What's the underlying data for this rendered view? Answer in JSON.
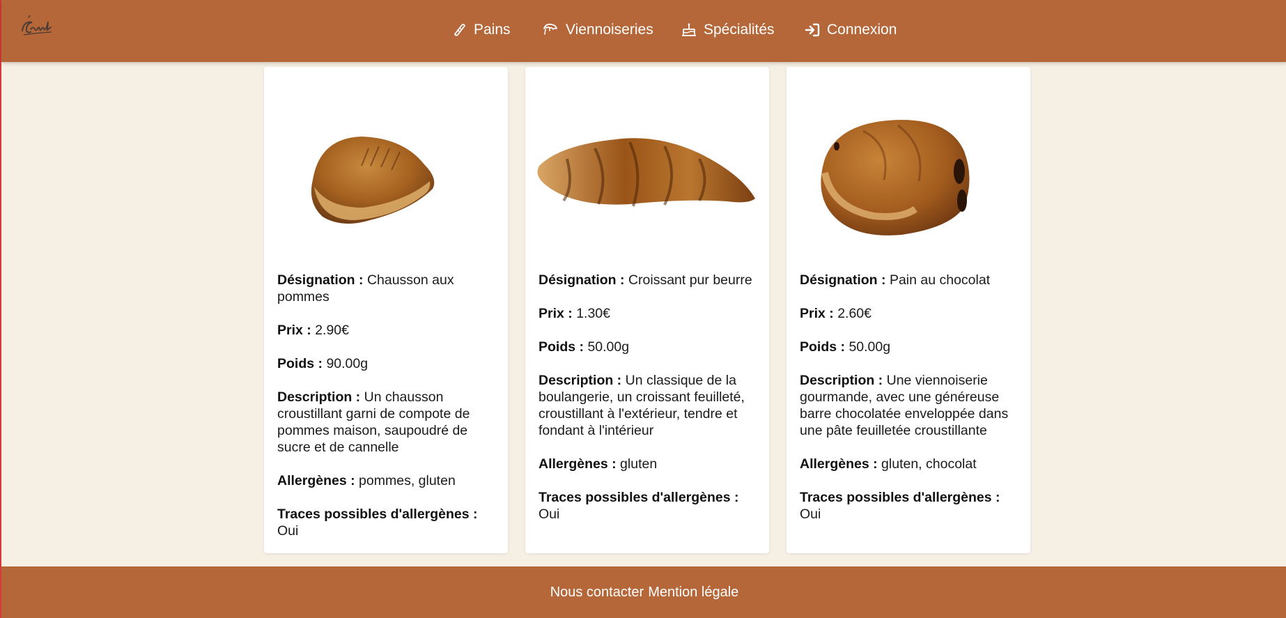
{
  "header": {
    "logo_text": "Le Fournil",
    "nav": [
      {
        "label": "Pains",
        "icon": "bread-icon"
      },
      {
        "label": "Viennoiseries",
        "icon": "croissant-icon"
      },
      {
        "label": "Spécialités",
        "icon": "cake-icon"
      },
      {
        "label": "Connexion",
        "icon": "sign-in-icon"
      }
    ]
  },
  "field_labels": {
    "designation": "Désignation :",
    "prix": "Prix :",
    "poids": "Poids :",
    "description": "Description :",
    "allergenes": "Allergènes :",
    "traces": "Traces possibles d'allergènes :"
  },
  "products": [
    {
      "image": "chausson-aux-pommes-image",
      "designation": "Chausson aux pommes",
      "prix": "2.90€",
      "poids": "90.00g",
      "description": "Un chausson croustillant garni de compote de pommes maison, saupoudré de sucre et de cannelle",
      "allergenes": "pommes, gluten",
      "traces": "Oui"
    },
    {
      "image": "croissant-image",
      "designation": "Croissant pur beurre",
      "prix": "1.30€",
      "poids": "50.00g",
      "description": "Un classique de la boulangerie, un croissant feuilleté, croustillant à l'extérieur, tendre et fondant à l'intérieur",
      "allergenes": "gluten",
      "traces": "Oui"
    },
    {
      "image": "pain-au-chocolat-image",
      "designation": "Pain au chocolat",
      "prix": "2.60€",
      "poids": "50.00g",
      "description": "Une viennoiserie gourmande, avec une généreuse barre chocolatée enveloppée dans une pâte feuilletée croustillante",
      "allergenes": "gluten, chocolat",
      "traces": "Oui"
    }
  ],
  "footer": {
    "contact": "Nous contacter",
    "legal": "Mention légale"
  },
  "colors": {
    "header_bg": "#b5673a",
    "page_bg": "#f6efe4",
    "card_bg": "#ffffff"
  }
}
